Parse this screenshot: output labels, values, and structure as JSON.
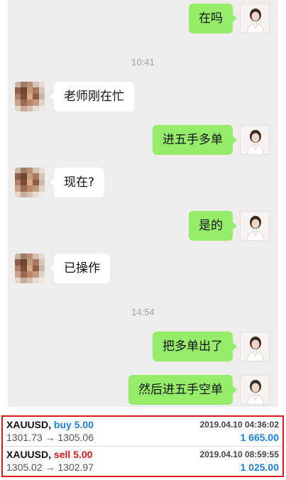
{
  "chat": {
    "messages": [
      {
        "side": "me",
        "text": "在吗"
      },
      {
        "type": "time",
        "text": "10:41"
      },
      {
        "side": "them",
        "text": "老师刚在忙"
      },
      {
        "side": "me",
        "text": "进五手多单"
      },
      {
        "side": "them",
        "text": "现在?"
      },
      {
        "side": "me",
        "text": "是的"
      },
      {
        "side": "them",
        "text": "已操作"
      },
      {
        "type": "time",
        "text": "14:54"
      },
      {
        "side": "me",
        "text": "把多单出了"
      },
      {
        "side": "me",
        "text": "然后进五手空单"
      }
    ]
  },
  "trades": [
    {
      "symbol": "XAUUSD,",
      "side": "buy 5.00",
      "side_color": "#1a7fe8",
      "prices": "1301.73 → 1305.06",
      "datetime": "2019.04.10 04:36:02",
      "profit": "1 665.00"
    },
    {
      "symbol": "XAUUSD,",
      "side": "sell 5.00",
      "side_color": "#e0151b",
      "prices": "1305.02 → 1302.97",
      "datetime": "2019.04.10 08:59:55",
      "profit": "1 025.00"
    }
  ],
  "colors": {
    "my_bubble": "#95ec69",
    "their_bubble": "#ffffff",
    "chat_bg": "#ededed",
    "highlight_border": "#e0151b",
    "profit": "#1a7fe8"
  }
}
